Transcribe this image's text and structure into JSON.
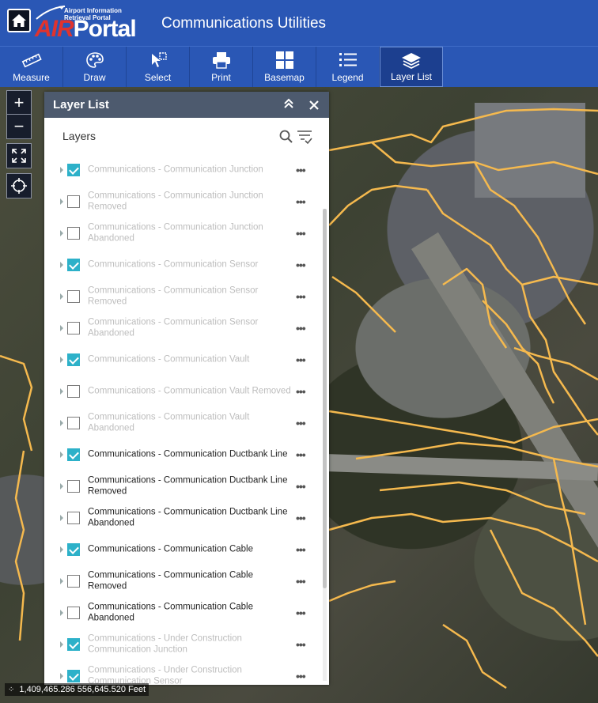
{
  "header": {
    "logo_small_line1": "Airport Information",
    "logo_small_line2": "Retrieval Portal",
    "logo_air": "AIR",
    "logo_portal": "Portal",
    "app_title": "Communications Utilities"
  },
  "toolbar": {
    "items": [
      {
        "label": "Measure",
        "icon": "ruler-icon"
      },
      {
        "label": "Draw",
        "icon": "palette-icon"
      },
      {
        "label": "Select",
        "icon": "select-icon"
      },
      {
        "label": "Print",
        "icon": "printer-icon"
      },
      {
        "label": "Basemap",
        "icon": "grid-icon"
      },
      {
        "label": "Legend",
        "icon": "list-icon"
      },
      {
        "label": "Layer List",
        "icon": "layers-icon"
      }
    ],
    "active": "Layer List"
  },
  "map_controls": {
    "zoom_in": "+",
    "zoom_out": "−"
  },
  "panel": {
    "title": "Layer List",
    "layers_label": "Layers",
    "layers": [
      {
        "name": "Communications - Communication Junction",
        "checked": true,
        "dim": true
      },
      {
        "name": "Communications - Communication Junction Removed",
        "checked": false,
        "dim": true
      },
      {
        "name": "Communications - Communication Junction Abandoned",
        "checked": false,
        "dim": true
      },
      {
        "name": "Communications - Communication Sensor",
        "checked": true,
        "dim": true
      },
      {
        "name": "Communications - Communication Sensor Removed",
        "checked": false,
        "dim": true
      },
      {
        "name": "Communications - Communication Sensor Abandoned",
        "checked": false,
        "dim": true
      },
      {
        "name": "Communications - Communication Vault",
        "checked": true,
        "dim": true
      },
      {
        "name": "Communications - Communication Vault Removed",
        "checked": false,
        "dim": true
      },
      {
        "name": "Communications - Communication Vault Abandoned",
        "checked": false,
        "dim": true
      },
      {
        "name": "Communications - Communication Ductbank Line",
        "checked": true,
        "dim": false
      },
      {
        "name": "Communications - Communication Ductbank Line Removed",
        "checked": false,
        "dim": false
      },
      {
        "name": "Communications - Communication Ductbank Line Abandoned",
        "checked": false,
        "dim": false
      },
      {
        "name": "Communications - Communication Cable",
        "checked": true,
        "dim": false
      },
      {
        "name": "Communications - Communication Cable Removed",
        "checked": false,
        "dim": false
      },
      {
        "name": "Communications - Communication Cable Abandoned",
        "checked": false,
        "dim": false
      },
      {
        "name": "Communications - Under Construction Communication Junction",
        "checked": true,
        "dim": true
      },
      {
        "name": "Communications - Under Construction Communication Sensor",
        "checked": true,
        "dim": true
      }
    ]
  },
  "coordinates": "1,409,465.286 556,645.520 Feet",
  "colors": {
    "header_bg": "#2a57b5",
    "panel_header_bg": "#4d5a6e",
    "checkbox_checked": "#2db1c9",
    "utility_line": "#f5b94e"
  }
}
